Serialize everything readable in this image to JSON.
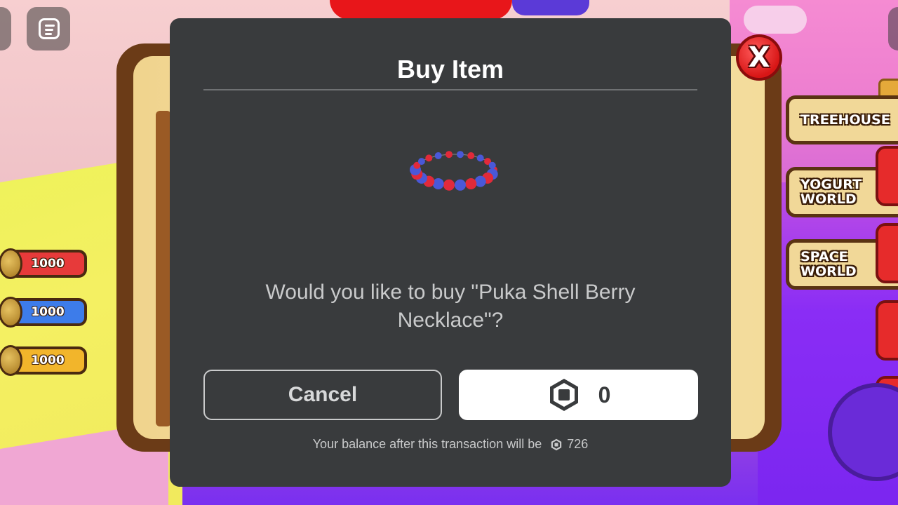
{
  "dialog": {
    "title": "Buy Item",
    "question": "Would you like to buy \"Puka Shell Berry Necklace\"?",
    "cancel_label": "Cancel",
    "price": "0",
    "balance_text": "Your balance after this transaction will be",
    "balance_amount": "726",
    "item_icon": "berry-necklace-image",
    "currency_icon": "robux-icon"
  },
  "close_button": {
    "label": "X"
  },
  "currency_pills": [
    {
      "value": "1000",
      "color": "#e73a3a"
    },
    {
      "value": "1000",
      "color": "#3d7cea"
    },
    {
      "value": "1000",
      "color": "#f2b52b"
    }
  ],
  "worlds": [
    {
      "label": "TREEHOUSE"
    },
    {
      "label": "YOGURT WORLD"
    },
    {
      "label": "SPACE WORLD"
    }
  ],
  "colors": {
    "modal_bg": "#393b3d",
    "buy_button_bg": "#ffffff",
    "close_red": "#e62b2b"
  }
}
